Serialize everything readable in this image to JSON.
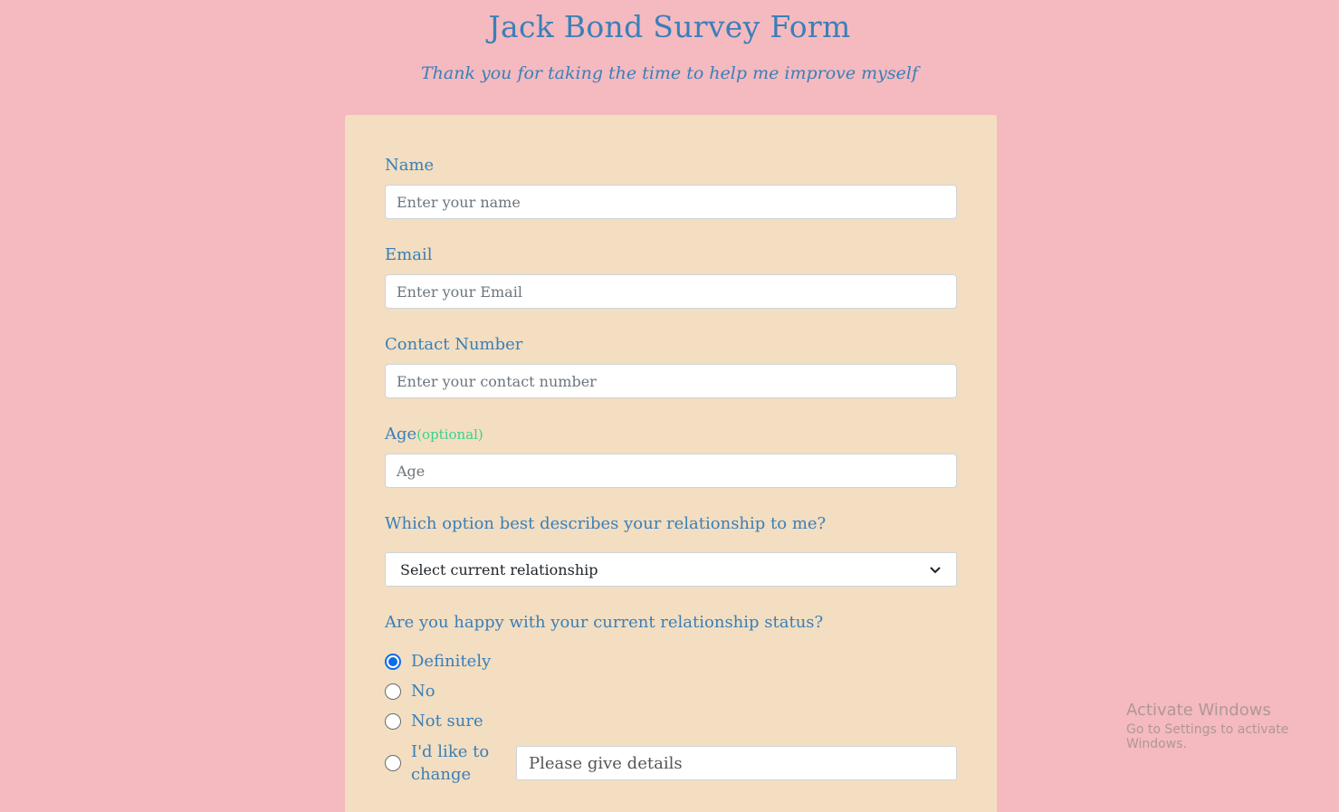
{
  "header": {
    "title": "Jack Bond Survey Form",
    "subtitle": "Thank you for taking the time to help me improve myself"
  },
  "form": {
    "name": {
      "label": "Name",
      "placeholder": "Enter your name",
      "value": ""
    },
    "email": {
      "label": "Email",
      "placeholder": "Enter your Email",
      "value": ""
    },
    "contact": {
      "label": "Contact Number",
      "placeholder": "Enter your contact number",
      "value": ""
    },
    "age": {
      "label": "Age",
      "optional_tag": "(optional)",
      "placeholder": "Age",
      "value": ""
    },
    "relationship": {
      "question": "Which option best describes your relationship to me?",
      "selected": "Select current relationship"
    },
    "happiness": {
      "question": "Are you happy with your current relationship status?",
      "options": [
        {
          "label": "Definitely",
          "checked": true
        },
        {
          "label": "No",
          "checked": false
        },
        {
          "label": "Not sure",
          "checked": false
        },
        {
          "label": "I'd like to change",
          "checked": false
        }
      ],
      "details_placeholder": "Please give details"
    }
  },
  "watermark": {
    "title": "Activate Windows",
    "subtitle": "Go to Settings to activate Windows."
  },
  "colors": {
    "page_background": "#f4babf",
    "card_background": "#f3dec1",
    "text_accent": "#3a7fb8",
    "optional_accent": "#3bd08f",
    "radio_checked": "#0b6ce6"
  }
}
